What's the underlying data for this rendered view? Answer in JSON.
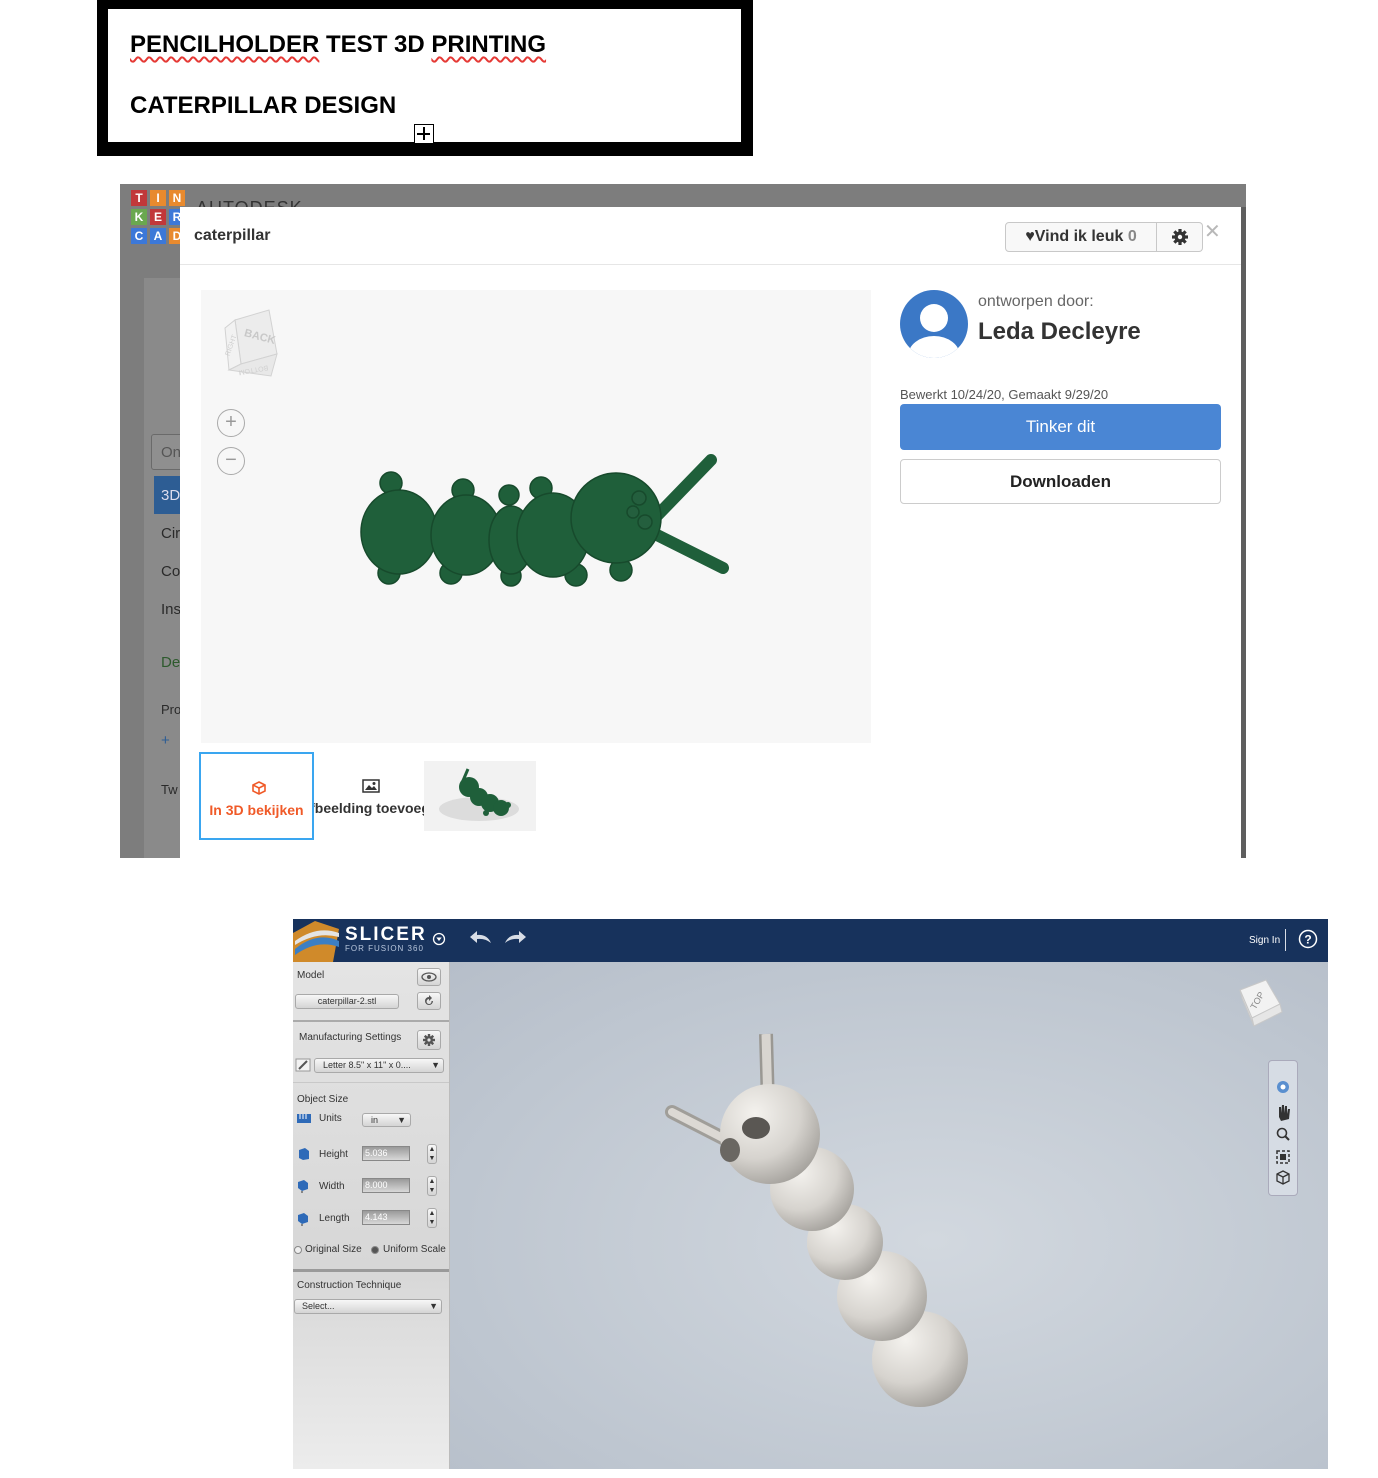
{
  "heading": {
    "line1_part1": "PENCILHOLDER",
    "line1_part2": " TEST 3D ",
    "line1_part3": "PRINTING",
    "line2": "CATERPILLAR DESIGN"
  },
  "tinkercad": {
    "logo_letters": [
      "T",
      "I",
      "N",
      "K",
      "E",
      "R",
      "C",
      "A",
      "D"
    ],
    "brand": "AUTODESK",
    "sidebar_partial": [
      "On",
      "3D",
      "Cir",
      "Co",
      "Ins",
      "De",
      "Pro",
      "+",
      "Tw"
    ],
    "modal": {
      "title": "caterpillar",
      "like_label": "Vind ik leuk ",
      "like_count": "0",
      "designed_by_label": "ontworpen door:",
      "designer_name": "Leda Decleyre",
      "edit_info": "Bewerkt 10/24/20, Gemaakt 9/29/20",
      "tinker_button": "Tinker dit",
      "download_button": "Downloaden",
      "thumb_3d_label": "In 3D bekijken",
      "thumb_add_label": "Afbeelding toevoegen",
      "viewcube_faces": [
        "RIGHT",
        "BACK",
        "BOTTOM"
      ],
      "model_color": "#1f5f3a"
    }
  },
  "slicer": {
    "app_title": "SLICER",
    "app_subtitle": "FOR FUSION 360",
    "sign_in": "Sign In",
    "model_label": "Model",
    "model_file": "caterpillar-2.stl",
    "manufacturing_label": "Manufacturing Settings",
    "manufacturing_value": "Letter 8.5\" x 11\" x 0....",
    "object_size_label": "Object Size",
    "units_label": "Units",
    "units_value": "in",
    "height_label": "Height",
    "height_value": "5.036",
    "width_label": "Width",
    "width_value": "8.000",
    "length_label": "Length",
    "length_value": "4.143",
    "original_size_label": "Original Size",
    "uniform_scale_label": "Uniform Scale",
    "construction_label": "Construction Technique",
    "construction_value": "Select...",
    "viewcube_face": "TOP",
    "bar_color": "#17325c"
  }
}
